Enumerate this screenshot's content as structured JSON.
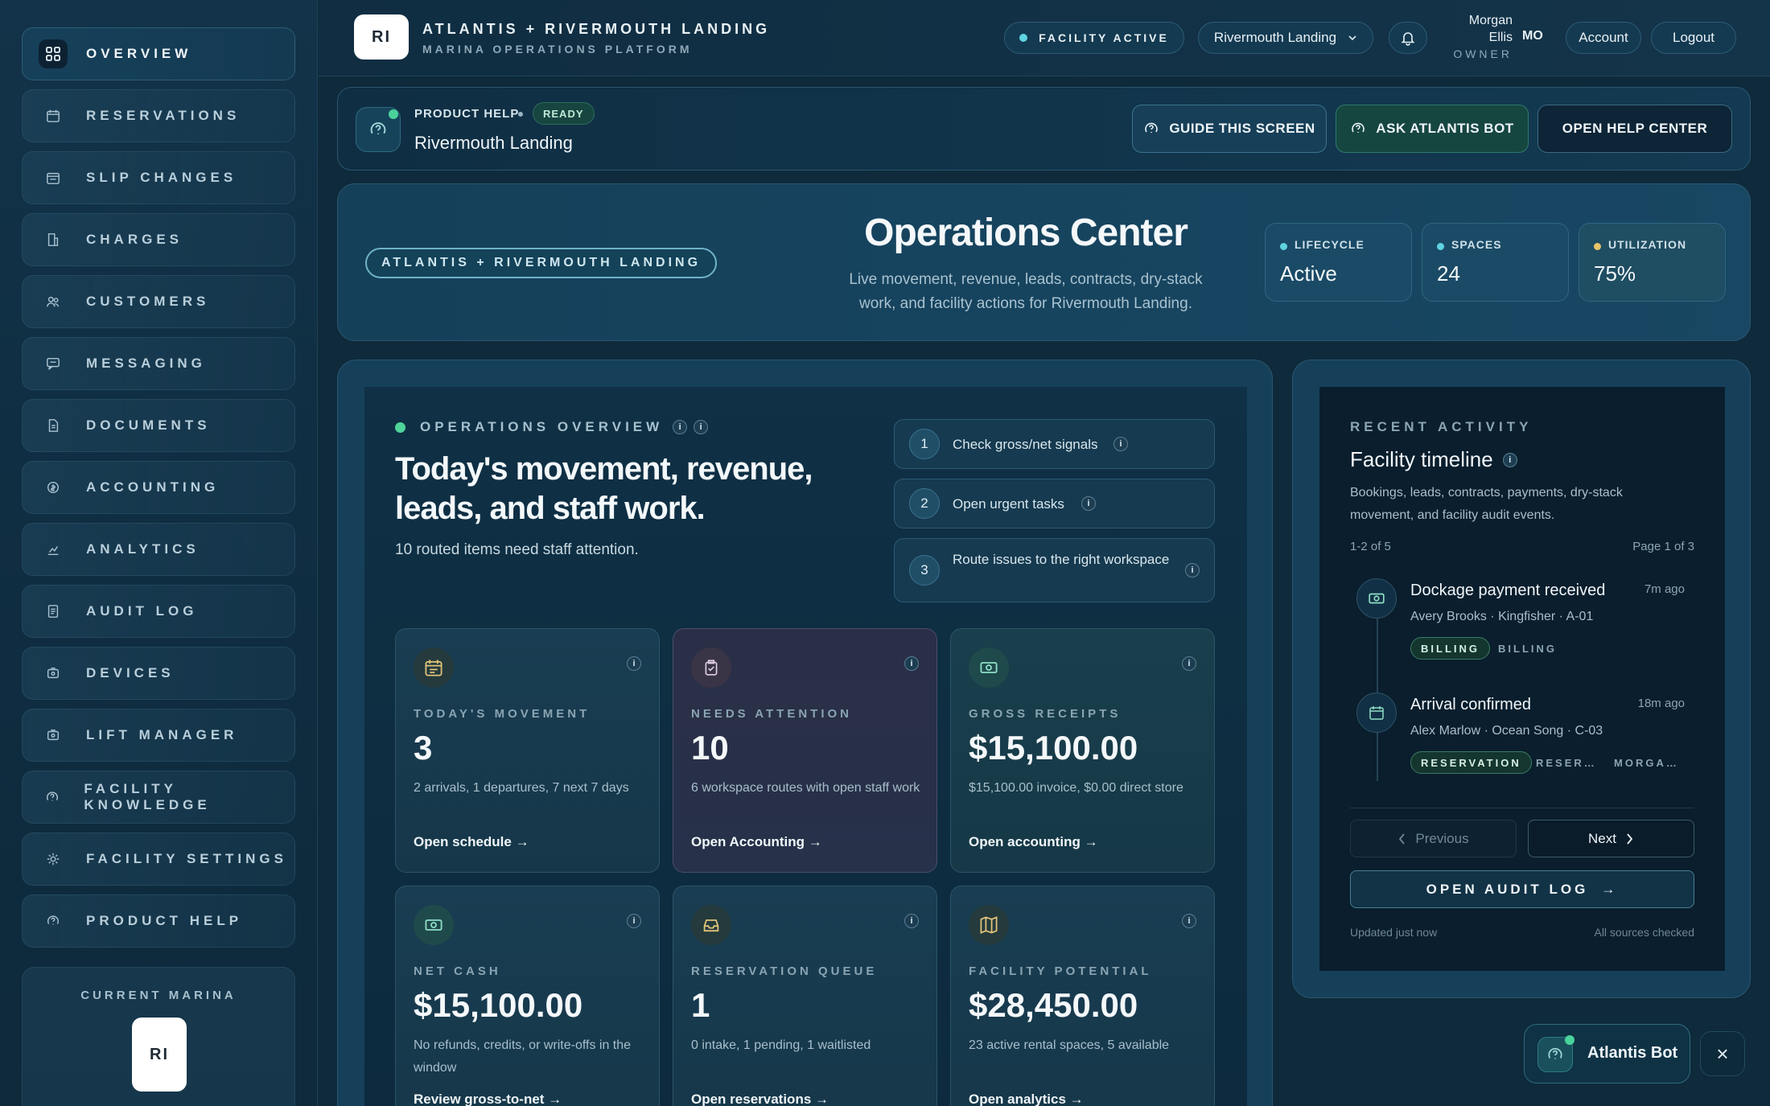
{
  "sidebar": {
    "items": [
      {
        "label": "OVERVIEW",
        "icon": "grid-icon",
        "active": true
      },
      {
        "label": "RESERVATIONS",
        "icon": "calendar-icon"
      },
      {
        "label": "SLIP CHANGES",
        "icon": "calendar-swap-icon"
      },
      {
        "label": "CHARGES",
        "icon": "receipt-icon"
      },
      {
        "label": "CUSTOMERS",
        "icon": "users-icon"
      },
      {
        "label": "MESSAGING",
        "icon": "chat-icon"
      },
      {
        "label": "DOCUMENTS",
        "icon": "document-icon"
      },
      {
        "label": "ACCOUNTING",
        "icon": "coin-icon"
      },
      {
        "label": "ANALYTICS",
        "icon": "chart-icon"
      },
      {
        "label": "AUDIT LOG",
        "icon": "log-icon"
      },
      {
        "label": "DEVICES",
        "icon": "device-icon"
      },
      {
        "label": "LIFT MANAGER",
        "icon": "lift-icon"
      },
      {
        "label": "FACILITY KNOWLEDGE",
        "icon": "help-circle-icon"
      },
      {
        "label": "FACILITY SETTINGS",
        "icon": "gear-icon"
      },
      {
        "label": "PRODUCT HELP",
        "icon": "help-circle-icon"
      }
    ],
    "current_marina": {
      "label": "CURRENT MARINA",
      "initials": "RI"
    }
  },
  "header": {
    "logo_initials": "RI",
    "title": "ATLANTIS + RIVERMOUTH LANDING",
    "subtitle": "MARINA OPERATIONS PLATFORM",
    "status": "FACILITY ACTIVE",
    "marina_select": "Rivermouth Landing",
    "user_first": "Morgan",
    "user_last": "Ellis",
    "user_role": "OWNER",
    "user_initials": "MO",
    "account": "Account",
    "logout": "Logout"
  },
  "help_bar": {
    "label": "PRODUCT HELP",
    "status": "READY",
    "title": "Rivermouth Landing",
    "guide": "GUIDE THIS SCREEN",
    "ask": "ASK ATLANTIS BOT",
    "open_help": "OPEN HELP CENTER"
  },
  "hero": {
    "tag": "ATLANTIS + RIVERMOUTH LANDING",
    "title": "Operations Center",
    "subtitle": "Live movement, revenue, leads, contracts, dry-stack work, and facility actions for Rivermouth Landing.",
    "stats": [
      {
        "label": "LIFECYCLE",
        "value": "Active",
        "dot": "#5fd4e0"
      },
      {
        "label": "SPACES",
        "value": "24",
        "dot": "#5fd4e0"
      },
      {
        "label": "UTILIZATION",
        "value": "75%",
        "dot": "#e8c56a"
      }
    ]
  },
  "ops": {
    "eyebrow": "OPERATIONS OVERVIEW",
    "headline": "Today's movement, revenue, leads, and staff work.",
    "sub": "10 routed items need staff attention.",
    "steps": [
      {
        "num": "1",
        "text": "Check gross/net signals"
      },
      {
        "num": "2",
        "text": "Open urgent tasks"
      },
      {
        "num": "3",
        "text": "Route issues to the right workspace"
      }
    ],
    "cards": [
      {
        "label": "TODAY'S MOVEMENT",
        "value": "3",
        "desc": "2 arrivals, 1 departures, 7 next 7 days",
        "link": "Open schedule",
        "icon": "calendar-icon"
      },
      {
        "label": "NEEDS ATTENTION",
        "value": "10",
        "desc": "6 workspace routes with open staff work",
        "link": "Open Accounting",
        "icon": "clipboard-icon"
      },
      {
        "label": "GROSS RECEIPTS",
        "value": "$15,100.00",
        "desc": "$15,100.00 invoice, $0.00 direct store",
        "link": "Open accounting",
        "icon": "cash-icon"
      },
      {
        "label": "NET CASH",
        "value": "$15,100.00",
        "desc": "No refunds, credits, or write-offs in the window",
        "link": "Review gross-to-net",
        "icon": "cash-icon"
      },
      {
        "label": "RESERVATION QUEUE",
        "value": "1",
        "desc": "0 intake, 1 pending, 1 waitlisted",
        "link": "Open reservations",
        "icon": "inbox-icon"
      },
      {
        "label": "FACILITY POTENTIAL",
        "value": "$28,450.00",
        "desc": "23 active rental spaces, 5 available",
        "link": "Open analytics",
        "icon": "map-icon"
      }
    ]
  },
  "activity": {
    "eyebrow": "RECENT ACTIVITY",
    "title": "Facility timeline",
    "desc": "Bookings, leads, contracts, payments, dry-stack movement, and facility audit events.",
    "range": "1-2 of 5",
    "page": "Page 1 of 3",
    "events": [
      {
        "title": "Dockage payment received",
        "time": "7m ago",
        "meta": "Avery Brooks · Kingfisher · A-01",
        "chip": "BILLING",
        "tags": [
          "BILLING"
        ],
        "icon": "cash-icon"
      },
      {
        "title": "Arrival confirmed",
        "time": "18m ago",
        "meta": "Alex Marlow · Ocean Song · C-03",
        "chip": "RESERVATION",
        "tags": [
          "RESER…",
          "MORGA…"
        ],
        "icon": "calendar-icon"
      }
    ],
    "prev": "Previous",
    "next": "Next",
    "audit": "OPEN AUDIT LOG",
    "updated": "Updated just now",
    "sources": "All sources checked"
  },
  "bot": {
    "label": "Atlantis Bot",
    "close": "×"
  }
}
